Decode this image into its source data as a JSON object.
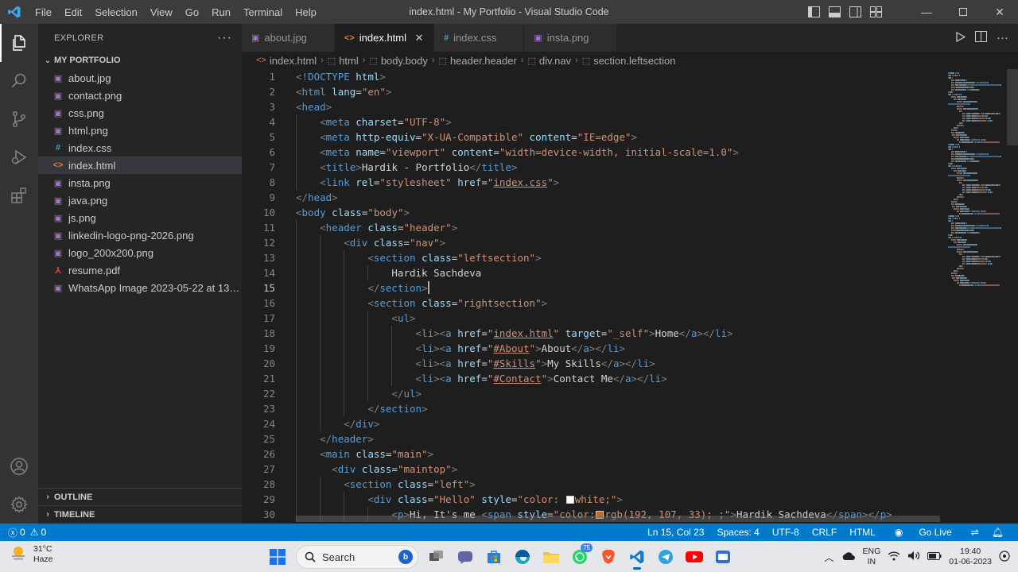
{
  "window": {
    "title": "index.html - My Portfolio - Visual Studio Code",
    "menu": [
      "File",
      "Edit",
      "Selection",
      "View",
      "Go",
      "Run",
      "Terminal",
      "Help"
    ]
  },
  "sidebar": {
    "title": "EXPLORER",
    "folder": "MY PORTFOLIO",
    "files": [
      {
        "name": "about.jpg",
        "icon": "image-icon",
        "color": "#a074c4"
      },
      {
        "name": "contact.png",
        "icon": "image-icon",
        "color": "#a074c4"
      },
      {
        "name": "css.png",
        "icon": "image-icon",
        "color": "#a074c4"
      },
      {
        "name": "html.png",
        "icon": "image-icon",
        "color": "#a074c4"
      },
      {
        "name": "index.css",
        "icon": "hash-icon",
        "color": "#519aba"
      },
      {
        "name": "index.html",
        "icon": "html-icon",
        "color": "#e37933",
        "selected": true
      },
      {
        "name": "insta.png",
        "icon": "image-icon",
        "color": "#a074c4"
      },
      {
        "name": "java.png",
        "icon": "image-icon",
        "color": "#a074c4"
      },
      {
        "name": "js.png",
        "icon": "image-icon",
        "color": "#a074c4"
      },
      {
        "name": "linkedin-logo-png-2026.png",
        "icon": "image-icon",
        "color": "#a074c4"
      },
      {
        "name": "logo_200x200.png",
        "icon": "image-icon",
        "color": "#a074c4"
      },
      {
        "name": "resume.pdf",
        "icon": "pdf-icon",
        "color": "#cc3e44"
      },
      {
        "name": "WhatsApp Image 2023-05-22 at 13.3...",
        "icon": "image-icon",
        "color": "#a074c4"
      }
    ],
    "outline": "OUTLINE",
    "timeline": "TIMELINE"
  },
  "tabs": [
    {
      "label": "about.jpg",
      "icon": "image-icon",
      "color": "#a074c4",
      "active": false
    },
    {
      "label": "index.html",
      "icon": "html-icon",
      "color": "#e37933",
      "active": true
    },
    {
      "label": "index.css",
      "icon": "hash-icon",
      "color": "#519aba",
      "active": false
    },
    {
      "label": "insta.png",
      "icon": "image-icon",
      "color": "#a074c4",
      "active": false
    }
  ],
  "breadcrumb": [
    "index.html",
    "html",
    "body.body",
    "header.header",
    "div.nav",
    "section.leftsection"
  ],
  "editor": {
    "cursor_line": 15,
    "lines": [
      [
        [
          "br",
          "<!"
        ],
        [
          "tag",
          "DOCTYPE"
        ],
        [
          "txt",
          " "
        ],
        [
          "attr",
          "html"
        ],
        [
          "br",
          ">"
        ]
      ],
      [
        [
          "br",
          "<"
        ],
        [
          "tag",
          "html"
        ],
        [
          "txt",
          " "
        ],
        [
          "attr",
          "lang"
        ],
        [
          "eq",
          "="
        ],
        [
          "str",
          "\"en\""
        ],
        [
          "br",
          ">"
        ]
      ],
      [
        [
          "br",
          "<"
        ],
        [
          "tag",
          "head"
        ],
        [
          "br",
          ">"
        ]
      ],
      [
        [
          "txt",
          "    "
        ],
        [
          "br",
          "<"
        ],
        [
          "tag",
          "meta"
        ],
        [
          "txt",
          " "
        ],
        [
          "attr",
          "charset"
        ],
        [
          "eq",
          "="
        ],
        [
          "str",
          "\"UTF-8\""
        ],
        [
          "br",
          ">"
        ]
      ],
      [
        [
          "txt",
          "    "
        ],
        [
          "br",
          "<"
        ],
        [
          "tag",
          "meta"
        ],
        [
          "txt",
          " "
        ],
        [
          "attr",
          "http-equiv"
        ],
        [
          "eq",
          "="
        ],
        [
          "str",
          "\"X-UA-Compatible\""
        ],
        [
          "txt",
          " "
        ],
        [
          "attr",
          "content"
        ],
        [
          "eq",
          "="
        ],
        [
          "str",
          "\"IE=edge\""
        ],
        [
          "br",
          ">"
        ]
      ],
      [
        [
          "txt",
          "    "
        ],
        [
          "br",
          "<"
        ],
        [
          "tag",
          "meta"
        ],
        [
          "txt",
          " "
        ],
        [
          "attr",
          "name"
        ],
        [
          "eq",
          "="
        ],
        [
          "str",
          "\"viewport\""
        ],
        [
          "txt",
          " "
        ],
        [
          "attr",
          "content"
        ],
        [
          "eq",
          "="
        ],
        [
          "str",
          "\"width=device-width, initial-scale=1.0\""
        ],
        [
          "br",
          ">"
        ]
      ],
      [
        [
          "txt",
          "    "
        ],
        [
          "br",
          "<"
        ],
        [
          "tag",
          "title"
        ],
        [
          "br",
          ">"
        ],
        [
          "txt",
          "Hardik - Portfolio"
        ],
        [
          "br",
          "</"
        ],
        [
          "tag",
          "title"
        ],
        [
          "br",
          ">"
        ]
      ],
      [
        [
          "txt",
          "    "
        ],
        [
          "br",
          "<"
        ],
        [
          "tag",
          "link"
        ],
        [
          "txt",
          " "
        ],
        [
          "attr",
          "rel"
        ],
        [
          "eq",
          "="
        ],
        [
          "str",
          "\"stylesheet\""
        ],
        [
          "txt",
          " "
        ],
        [
          "attr",
          "href"
        ],
        [
          "eq",
          "="
        ],
        [
          "str",
          "\""
        ],
        [
          "strlink",
          "index.css"
        ],
        [
          "str",
          "\""
        ],
        [
          "br",
          ">"
        ]
      ],
      [
        [
          "br",
          "</"
        ],
        [
          "tag",
          "head"
        ],
        [
          "br",
          ">"
        ]
      ],
      [
        [
          "br",
          "<"
        ],
        [
          "tag",
          "body"
        ],
        [
          "txt",
          " "
        ],
        [
          "attr",
          "class"
        ],
        [
          "eq",
          "="
        ],
        [
          "str",
          "\"body\""
        ],
        [
          "br",
          ">"
        ]
      ],
      [
        [
          "txt",
          "    "
        ],
        [
          "br",
          "<"
        ],
        [
          "tag",
          "header"
        ],
        [
          "txt",
          " "
        ],
        [
          "attr",
          "class"
        ],
        [
          "eq",
          "="
        ],
        [
          "str",
          "\"header\""
        ],
        [
          "br",
          ">"
        ]
      ],
      [
        [
          "txt",
          "        "
        ],
        [
          "br",
          "<"
        ],
        [
          "tag",
          "div"
        ],
        [
          "txt",
          " "
        ],
        [
          "attr",
          "class"
        ],
        [
          "eq",
          "="
        ],
        [
          "str",
          "\"nav\""
        ],
        [
          "br",
          ">"
        ]
      ],
      [
        [
          "txt",
          "            "
        ],
        [
          "br",
          "<"
        ],
        [
          "tag",
          "section"
        ],
        [
          "txt",
          " "
        ],
        [
          "attr",
          "class"
        ],
        [
          "eq",
          "="
        ],
        [
          "str",
          "\"leftsection\""
        ],
        [
          "br",
          ">"
        ]
      ],
      [
        [
          "txt",
          "                Hardik Sachdeva"
        ]
      ],
      [
        [
          "txt",
          "            "
        ],
        [
          "br",
          "</"
        ],
        [
          "tag",
          "section"
        ],
        [
          "br",
          ">"
        ],
        [
          "cursor",
          ""
        ]
      ],
      [
        [
          "txt",
          "            "
        ],
        [
          "br",
          "<"
        ],
        [
          "tag",
          "section"
        ],
        [
          "txt",
          " "
        ],
        [
          "attr",
          "class"
        ],
        [
          "eq",
          "="
        ],
        [
          "str",
          "\"rightsection\""
        ],
        [
          "br",
          ">"
        ]
      ],
      [
        [
          "txt",
          "                "
        ],
        [
          "br",
          "<"
        ],
        [
          "tag",
          "ul"
        ],
        [
          "br",
          ">"
        ]
      ],
      [
        [
          "txt",
          "                    "
        ],
        [
          "br",
          "<"
        ],
        [
          "tag",
          "li"
        ],
        [
          "br",
          "><"
        ],
        [
          "tag",
          "a"
        ],
        [
          "txt",
          " "
        ],
        [
          "attr",
          "href"
        ],
        [
          "eq",
          "="
        ],
        [
          "str",
          "\""
        ],
        [
          "strlink",
          "index.html"
        ],
        [
          "str",
          "\""
        ],
        [
          "txt",
          " "
        ],
        [
          "attr",
          "target"
        ],
        [
          "eq",
          "="
        ],
        [
          "str",
          "\"_self\""
        ],
        [
          "br",
          ">"
        ],
        [
          "txt",
          "Home"
        ],
        [
          "br",
          "</"
        ],
        [
          "tag",
          "a"
        ],
        [
          "br",
          "></"
        ],
        [
          "tag",
          "li"
        ],
        [
          "br",
          ">"
        ]
      ],
      [
        [
          "txt",
          "                    "
        ],
        [
          "br",
          "<"
        ],
        [
          "tag",
          "li"
        ],
        [
          "br",
          "><"
        ],
        [
          "tag",
          "a"
        ],
        [
          "txt",
          " "
        ],
        [
          "attr",
          "href"
        ],
        [
          "eq",
          "="
        ],
        [
          "str",
          "\""
        ],
        [
          "strlink",
          "#About"
        ],
        [
          "str",
          "\""
        ],
        [
          "br",
          ">"
        ],
        [
          "txt",
          "About"
        ],
        [
          "br",
          "</"
        ],
        [
          "tag",
          "a"
        ],
        [
          "br",
          "></"
        ],
        [
          "tag",
          "li"
        ],
        [
          "br",
          ">"
        ]
      ],
      [
        [
          "txt",
          "                    "
        ],
        [
          "br",
          "<"
        ],
        [
          "tag",
          "li"
        ],
        [
          "br",
          "><"
        ],
        [
          "tag",
          "a"
        ],
        [
          "txt",
          " "
        ],
        [
          "attr",
          "href"
        ],
        [
          "eq",
          "="
        ],
        [
          "str",
          "\""
        ],
        [
          "strlink",
          "#Skills"
        ],
        [
          "str",
          "\""
        ],
        [
          "br",
          ">"
        ],
        [
          "txt",
          "My Skills"
        ],
        [
          "br",
          "</"
        ],
        [
          "tag",
          "a"
        ],
        [
          "br",
          "></"
        ],
        [
          "tag",
          "li"
        ],
        [
          "br",
          ">"
        ]
      ],
      [
        [
          "txt",
          "                    "
        ],
        [
          "br",
          "<"
        ],
        [
          "tag",
          "li"
        ],
        [
          "br",
          "><"
        ],
        [
          "tag",
          "a"
        ],
        [
          "txt",
          " "
        ],
        [
          "attr",
          "href"
        ],
        [
          "eq",
          "="
        ],
        [
          "str",
          "\""
        ],
        [
          "strlink",
          "#Contact"
        ],
        [
          "str",
          "\""
        ],
        [
          "br",
          ">"
        ],
        [
          "txt",
          "Contact Me"
        ],
        [
          "br",
          "</"
        ],
        [
          "tag",
          "a"
        ],
        [
          "br",
          "></"
        ],
        [
          "tag",
          "li"
        ],
        [
          "br",
          ">"
        ]
      ],
      [
        [
          "txt",
          "                "
        ],
        [
          "br",
          "</"
        ],
        [
          "tag",
          "ul"
        ],
        [
          "br",
          ">"
        ]
      ],
      [
        [
          "txt",
          "            "
        ],
        [
          "br",
          "</"
        ],
        [
          "tag",
          "section"
        ],
        [
          "br",
          ">"
        ]
      ],
      [
        [
          "txt",
          "        "
        ],
        [
          "br",
          "</"
        ],
        [
          "tag",
          "div"
        ],
        [
          "br",
          ">"
        ]
      ],
      [
        [
          "txt",
          "    "
        ],
        [
          "br",
          "</"
        ],
        [
          "tag",
          "header"
        ],
        [
          "br",
          ">"
        ]
      ],
      [
        [
          "txt",
          "    "
        ],
        [
          "br",
          "<"
        ],
        [
          "tag",
          "main"
        ],
        [
          "txt",
          " "
        ],
        [
          "attr",
          "class"
        ],
        [
          "eq",
          "="
        ],
        [
          "str",
          "\"main\""
        ],
        [
          "br",
          ">"
        ]
      ],
      [
        [
          "txt",
          "      "
        ],
        [
          "br",
          "<"
        ],
        [
          "tag",
          "div"
        ],
        [
          "txt",
          " "
        ],
        [
          "attr",
          "class"
        ],
        [
          "eq",
          "="
        ],
        [
          "str",
          "\"maintop\""
        ],
        [
          "br",
          ">"
        ]
      ],
      [
        [
          "txt",
          "        "
        ],
        [
          "br",
          "<"
        ],
        [
          "tag",
          "section"
        ],
        [
          "txt",
          " "
        ],
        [
          "attr",
          "class"
        ],
        [
          "eq",
          "="
        ],
        [
          "str",
          "\"left\""
        ],
        [
          "br",
          ">"
        ]
      ],
      [
        [
          "txt",
          "            "
        ],
        [
          "br",
          "<"
        ],
        [
          "tag",
          "div"
        ],
        [
          "txt",
          " "
        ],
        [
          "attr",
          "class"
        ],
        [
          "eq",
          "="
        ],
        [
          "str",
          "\"Hello\""
        ],
        [
          "txt",
          " "
        ],
        [
          "attr",
          "style"
        ],
        [
          "eq",
          "="
        ],
        [
          "str",
          "\"color: "
        ],
        [
          "swatch",
          "#ffffff"
        ],
        [
          "str",
          "white;\""
        ],
        [
          "br",
          ">"
        ]
      ],
      [
        [
          "txt",
          "                "
        ],
        [
          "br",
          "<"
        ],
        [
          "tag",
          "p"
        ],
        [
          "br",
          ">"
        ],
        [
          "txt",
          "Hi, It's me "
        ],
        [
          "br",
          "<"
        ],
        [
          "tag",
          "span"
        ],
        [
          "txt",
          " "
        ],
        [
          "attr",
          "style"
        ],
        [
          "eq",
          "="
        ],
        [
          "str",
          "\"color:"
        ],
        [
          "swatch",
          "#c06b21"
        ],
        [
          "str",
          "rgb(192, 107, 33); ;\""
        ],
        [
          "br",
          ">"
        ],
        [
          "txt",
          "Hardik Sachdeva"
        ],
        [
          "br",
          "</"
        ],
        [
          "tag",
          "span"
        ],
        [
          "br",
          "></"
        ],
        [
          "tag",
          "p"
        ],
        [
          "br",
          ">"
        ]
      ]
    ]
  },
  "statusbar": {
    "errors": "0",
    "warnings": "0",
    "position": "Ln 15, Col 23",
    "spaces": "Spaces: 4",
    "encoding": "UTF-8",
    "eol": "CRLF",
    "language": "HTML",
    "golive": "Go Live"
  },
  "taskbar": {
    "temp": "31°C",
    "weather": "Haze",
    "search": "Search",
    "whatsapp_badge": "75",
    "lang1": "ENG",
    "lang2": "IN",
    "time": "19:40",
    "date": "01-06-2023"
  },
  "colors": {
    "accent": "#007acc",
    "titlebar": "#3c3c3c",
    "sidebar": "#252526",
    "editor": "#1e1e1e"
  }
}
